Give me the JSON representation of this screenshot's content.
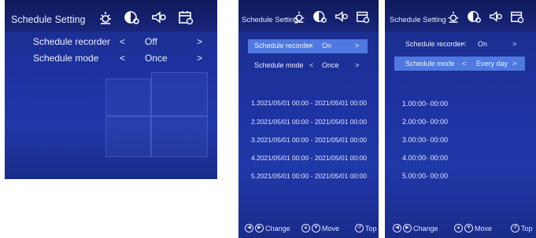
{
  "panels": [
    {
      "title": "Schedule Setting",
      "icons": [
        "sun-gear-icon",
        "display-gear-icon",
        "speaker-gear-icon",
        "calendar-icon"
      ],
      "rows": [
        {
          "label": "Schedule recorder",
          "left": "<",
          "value": "Off",
          "right": ">"
        },
        {
          "label": "Schedule mode",
          "left": "<",
          "value": "Once",
          "right": ">"
        }
      ]
    },
    {
      "title": "Schedule Setting",
      "icons": [
        "sun-gear-icon",
        "display-gear-icon",
        "speaker-gear-icon",
        "calendar-icon"
      ],
      "rows": [
        {
          "label": "Schedule recorder",
          "left": "<",
          "value": "On",
          "right": ">"
        },
        {
          "label": "Schedule mode",
          "left": "<",
          "value": "Once",
          "right": ">"
        }
      ],
      "schedule": [
        "1.2021/05/01 00:00  -  2021/05/01 00:00",
        "2.2021/05/01 00:00  -  2021/05/01 00:00",
        "3.2021/05/01 00:00  -  2021/05/01 00:00",
        "4.2021/05/01 00:00  -  2021/05/01 00:00",
        "5.2021/05/01 00:00  -  2021/05/01 00:00"
      ],
      "footer": {
        "change": "Change",
        "move": "Move",
        "top": "Top"
      }
    },
    {
      "title": "Schedule Setting",
      "icons": [
        "sun-gear-icon",
        "display-gear-icon",
        "speaker-gear-icon",
        "calendar-icon"
      ],
      "rows": [
        {
          "label": "Schedule recorder",
          "left": "<",
          "value": "On",
          "right": ">"
        },
        {
          "label": "Schedule mode",
          "left": "<",
          "value": "Every day",
          "right": ">"
        }
      ],
      "schedule": [
        "1.00:00-  00:00",
        "2.00:00-  00:00",
        "3.00:00-  00:00",
        "4.00:00-  00:00",
        "5.00:00-  00:00"
      ],
      "footer": {
        "change": "Change",
        "move": "Move",
        "top": "Top"
      }
    }
  ],
  "colors": {
    "background": "#1d32a0",
    "highlight": "#4f79e0",
    "text": "#eef1ff"
  }
}
